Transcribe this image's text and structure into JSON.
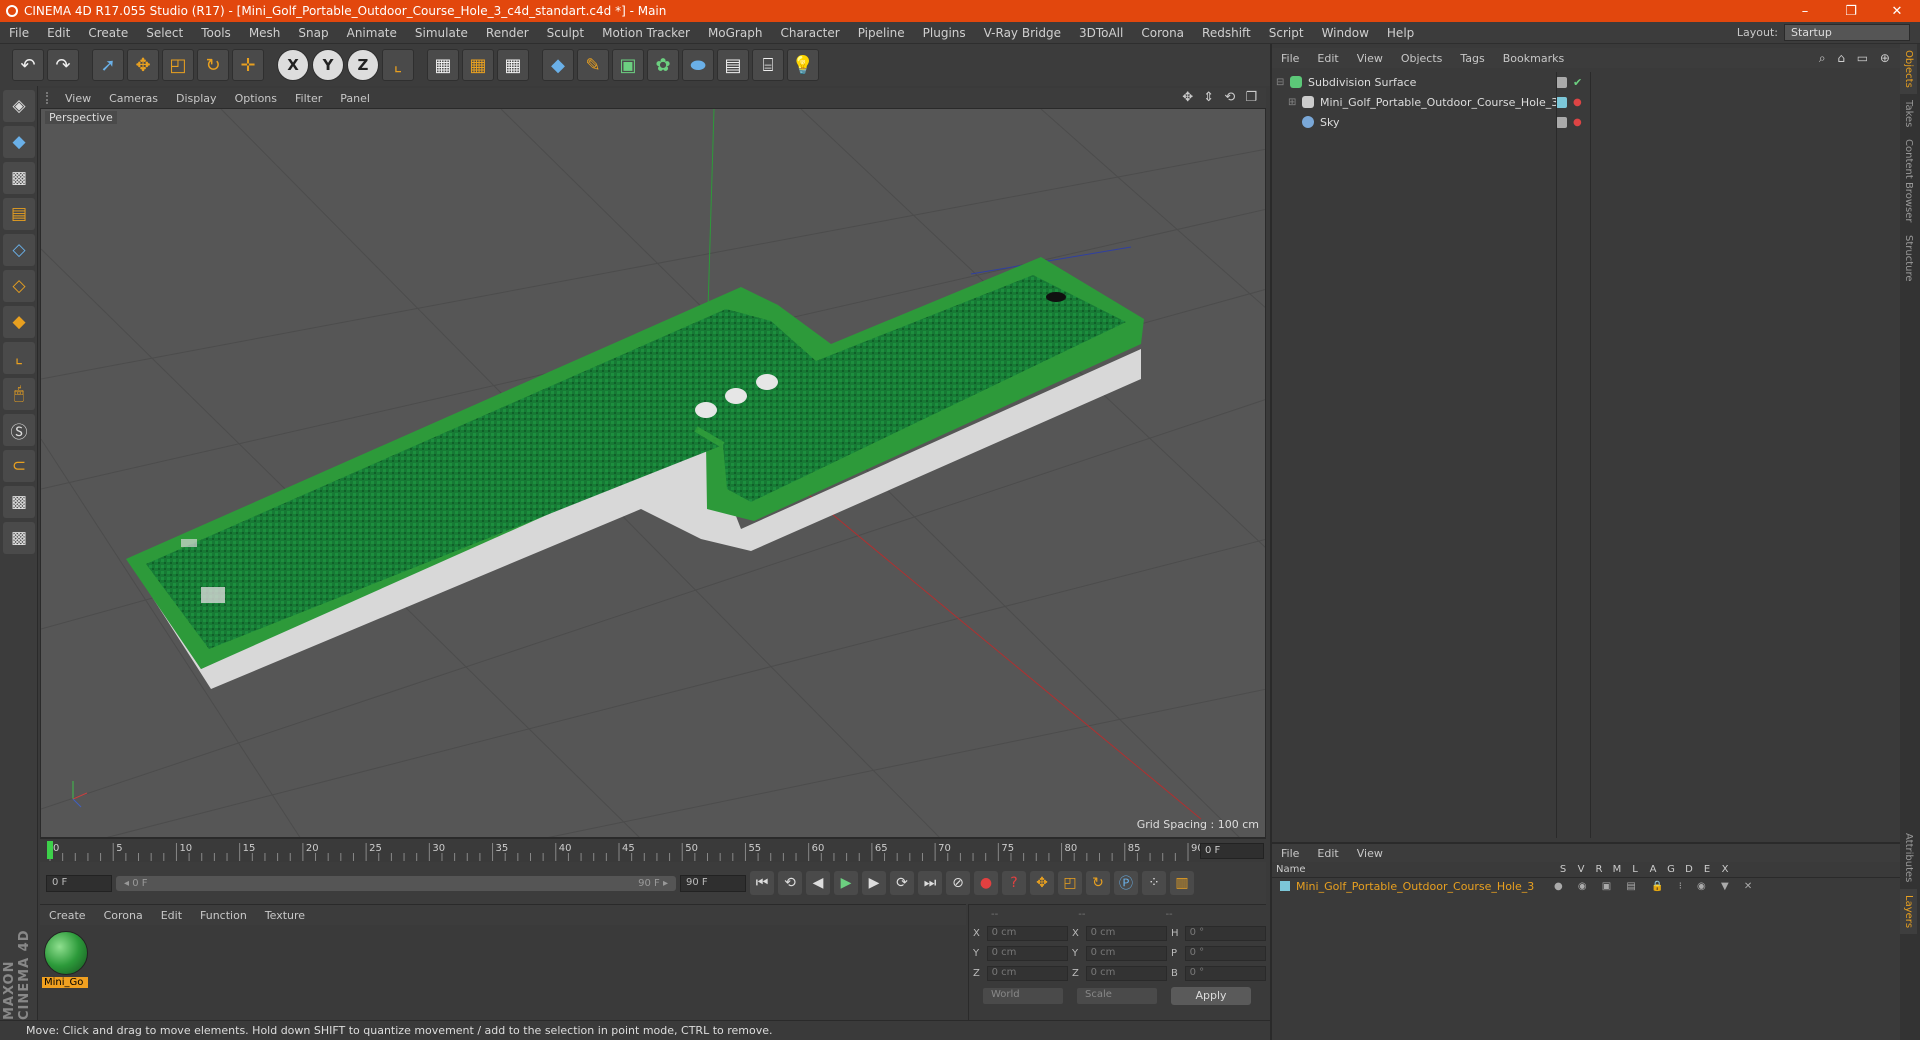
{
  "window": {
    "title": "CINEMA 4D R17.055 Studio (R17) - [Mini_Golf_Portable_Outdoor_Course_Hole_3_c4d_standart.c4d *] - Main",
    "minimize": "–",
    "restore": "❐",
    "close": "✕"
  },
  "menu": [
    "File",
    "Edit",
    "Create",
    "Select",
    "Tools",
    "Mesh",
    "Snap",
    "Animate",
    "Simulate",
    "Render",
    "Sculpt",
    "Motion Tracker",
    "MoGraph",
    "Character",
    "Pipeline",
    "Plugins",
    "V-Ray Bridge",
    "3DToAll",
    "Corona",
    "Redshift",
    "Script",
    "Window",
    "Help"
  ],
  "layout": {
    "label": "Layout:",
    "value": "Startup"
  },
  "viewport": {
    "menu": [
      "View",
      "Cameras",
      "Display",
      "Options",
      "Filter",
      "Panel"
    ],
    "label": "Perspective",
    "grid_spacing": "Grid Spacing : 100 cm",
    "nav_icons": "✥ ⇕ ⟲ ❐"
  },
  "timeline": {
    "ticks": [
      "0",
      "5",
      "10",
      "15",
      "20",
      "25",
      "30",
      "35",
      "40",
      "45",
      "50",
      "55",
      "60",
      "65",
      "70",
      "75",
      "80",
      "85",
      "90"
    ],
    "current_frame": "0 F"
  },
  "transport": {
    "start_field": "0 F",
    "range_start": "◂ 0 F",
    "range_end": "90 F ▸",
    "end_field": "90 F"
  },
  "materials": {
    "menu": [
      "Create",
      "Corona",
      "Edit",
      "Function",
      "Texture"
    ],
    "swatch_label": "Mini_Go"
  },
  "coords": {
    "headers": [
      "--",
      "--",
      "--"
    ],
    "rows": [
      {
        "a": "X",
        "av": "0 cm",
        "b": "X",
        "bv": "0 cm",
        "c": "H",
        "cv": "0 °"
      },
      {
        "a": "Y",
        "av": "0 cm",
        "b": "Y",
        "bv": "0 cm",
        "c": "P",
        "cv": "0 °"
      },
      {
        "a": "Z",
        "av": "0 cm",
        "b": "Z",
        "bv": "0 cm",
        "c": "B",
        "cv": "0 °"
      }
    ],
    "space": "World",
    "mode": "Scale",
    "apply": "Apply"
  },
  "status": "Move: Click and drag to move elements. Hold down SHIFT to quantize movement / add to the selection in point mode, CTRL to remove.",
  "objects": {
    "menu": [
      "File",
      "Edit",
      "View",
      "Objects",
      "Tags",
      "Bookmarks"
    ],
    "tree": [
      {
        "name": "Subdivision Surface",
        "icon_color": "#5cc878",
        "expander": "⊟"
      },
      {
        "name": "Mini_Golf_Portable_Outdoor_Course_Hole_3",
        "icon_color": "#cccccc",
        "expander": "⊞"
      },
      {
        "name": "Sky",
        "icon_color": "#7aa8d8",
        "expander": ""
      }
    ]
  },
  "side_tabs": [
    "Objects",
    "Takes",
    "Content Browser",
    "Structure"
  ],
  "side_tabs_bottom": [
    "Attributes",
    "Layers"
  ],
  "layers": {
    "menu": [
      "File",
      "Edit",
      "View"
    ],
    "columns": [
      "Name",
      "S",
      "V",
      "R",
      "M",
      "L",
      "A",
      "G",
      "D",
      "E",
      "X"
    ],
    "row": "Mini_Golf_Portable_Outdoor_Course_Hole_3"
  },
  "branding": "MAXON CINEMA 4D",
  "colors": {
    "accent": "#e8a020",
    "title_bar": "#e2470d",
    "turf": "#1f8a3a"
  }
}
